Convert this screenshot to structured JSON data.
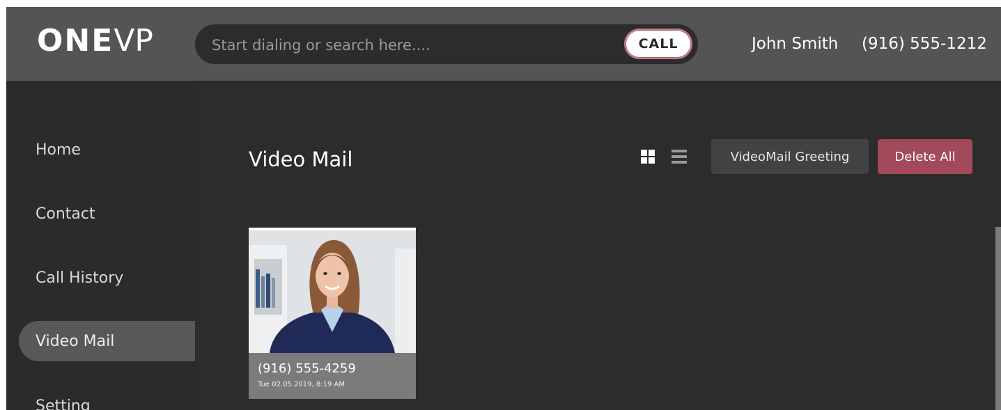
{
  "header": {
    "logo_bold": "ONE",
    "logo_light": "VP",
    "search_placeholder": "Start dialing or search here....",
    "call_label": "CALL",
    "user_name": "John Smith",
    "user_phone": "(916) 555-1212"
  },
  "sidebar": {
    "items": [
      {
        "label": "Home",
        "active": false
      },
      {
        "label": "Contact",
        "active": false
      },
      {
        "label": "Call History",
        "active": false
      },
      {
        "label": "Video Mail",
        "active": true
      },
      {
        "label": "Setting",
        "active": false
      }
    ]
  },
  "main": {
    "title": "Video Mail",
    "greeting_button": "VideoMail Greeting",
    "delete_all_button": "Delete All",
    "view_modes": [
      "grid-icon",
      "list-icon"
    ],
    "selected_view": "grid",
    "videomails": [
      {
        "phone": "(916) 555-4259",
        "timestamp": "Tue 02.05.2019, 8:19 AM",
        "thumbnail": "woman-portrait"
      }
    ]
  },
  "colors": {
    "header_bg": "#545456",
    "app_bg": "#2c2c2c",
    "delete_button": "#a24a5a",
    "active_nav": "#58585a"
  }
}
